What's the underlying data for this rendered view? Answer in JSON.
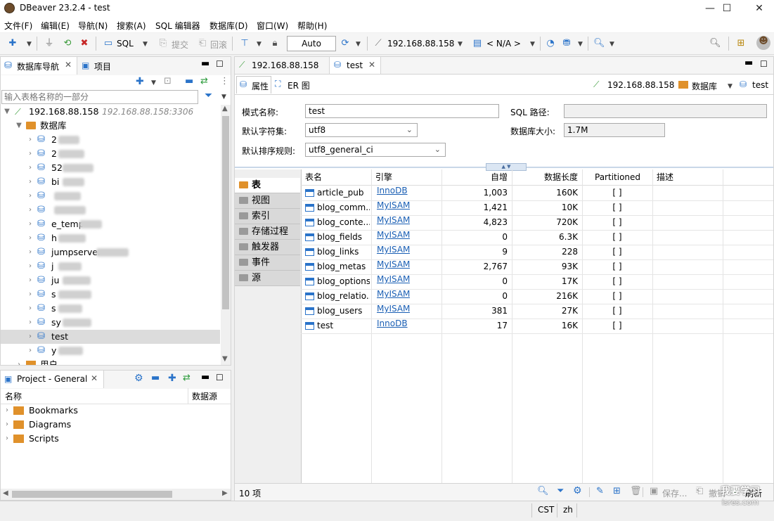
{
  "window": {
    "title": "DBeaver 23.2.4 - test",
    "minimize": "—",
    "maximize": "☐",
    "close": "✕"
  },
  "menu": [
    "文件(F)",
    "编辑(E)",
    "导航(N)",
    "搜索(A)",
    "SQL 编辑器",
    "数据库(D)",
    "窗口(W)",
    "帮助(H)"
  ],
  "toolbar": {
    "sql": "SQL",
    "commit": "提交",
    "rollback": "回滚",
    "tx_mode": "Auto",
    "connection": "192.168.88.158",
    "schema": "< N/A >"
  },
  "navigator": {
    "tab_label": "数据库导航",
    "projects_tab": "项目",
    "filter_placeholder": "输入表格名称的一部分",
    "connection": "192.168.88.158",
    "connection_host": "- 192.168.88.158:3306",
    "folder": "数据库",
    "databases": [
      "2",
      "2",
      "52",
      "bi",
      "",
      "",
      "e_temp",
      "h",
      "jumpserver",
      "j",
      "ju",
      "s",
      "s",
      "sy",
      "test",
      "y"
    ],
    "selected": "test",
    "more": "用户"
  },
  "project_panel": {
    "tab_label": "Project - General",
    "col_name": "名称",
    "col_source": "数据源",
    "items": [
      "Bookmarks",
      "Diagrams",
      "Scripts"
    ]
  },
  "editor": {
    "tabs": [
      "192.168.88.158",
      "test"
    ],
    "subtabs": [
      "属性",
      "ER 图"
    ],
    "crumbs": [
      "192.168.88.158",
      "数据库",
      "test"
    ],
    "props": {
      "schema_name_label": "模式名称:",
      "schema_name": "test",
      "sql_path_label": "SQL 路径:",
      "sql_path": "",
      "charset_label": "默认字符集:",
      "charset": "utf8",
      "db_size_label": "数据库大小:",
      "db_size": "1.7M",
      "collation_label": "默认排序规则:",
      "collation": "utf8_general_ci"
    },
    "side_tabs": [
      "表",
      "视图",
      "索引",
      "存储过程",
      "触发器",
      "事件",
      "源"
    ],
    "columns": [
      "表名",
      "引擎",
      "自增",
      "数据长度",
      "Partitioned",
      "描述"
    ],
    "rows": [
      {
        "name": "article_pub",
        "engine": "InnoDB",
        "auto": "1,003",
        "len": "160K",
        "part": "[ ]"
      },
      {
        "name": "blog_comm...",
        "engine": "MyISAM",
        "auto": "1,421",
        "len": "10K",
        "part": "[ ]"
      },
      {
        "name": "blog_conte...",
        "engine": "MyISAM",
        "auto": "4,823",
        "len": "720K",
        "part": "[ ]"
      },
      {
        "name": "blog_fields",
        "engine": "MyISAM",
        "auto": "0",
        "len": "6.3K",
        "part": "[ ]"
      },
      {
        "name": "blog_links",
        "engine": "MyISAM",
        "auto": "9",
        "len": "228",
        "part": "[ ]"
      },
      {
        "name": "blog_metas",
        "engine": "MyISAM",
        "auto": "2,767",
        "len": "93K",
        "part": "[ ]"
      },
      {
        "name": "blog_options",
        "engine": "MyISAM",
        "auto": "0",
        "len": "17K",
        "part": "[ ]"
      },
      {
        "name": "blog_relatio...",
        "engine": "MyISAM",
        "auto": "0",
        "len": "216K",
        "part": "[ ]"
      },
      {
        "name": "blog_users",
        "engine": "MyISAM",
        "auto": "381",
        "len": "27K",
        "part": "[ ]"
      },
      {
        "name": "test",
        "engine": "InnoDB",
        "auto": "17",
        "len": "16K",
        "part": "[ ]"
      }
    ],
    "count": "10 项",
    "save": "保存...",
    "revert": "撤销",
    "refresh": "刷新"
  },
  "status": {
    "timezone": "CST",
    "locale": "zh"
  },
  "watermark": {
    "line1": "我要学习",
    "line2": "isres.com"
  }
}
